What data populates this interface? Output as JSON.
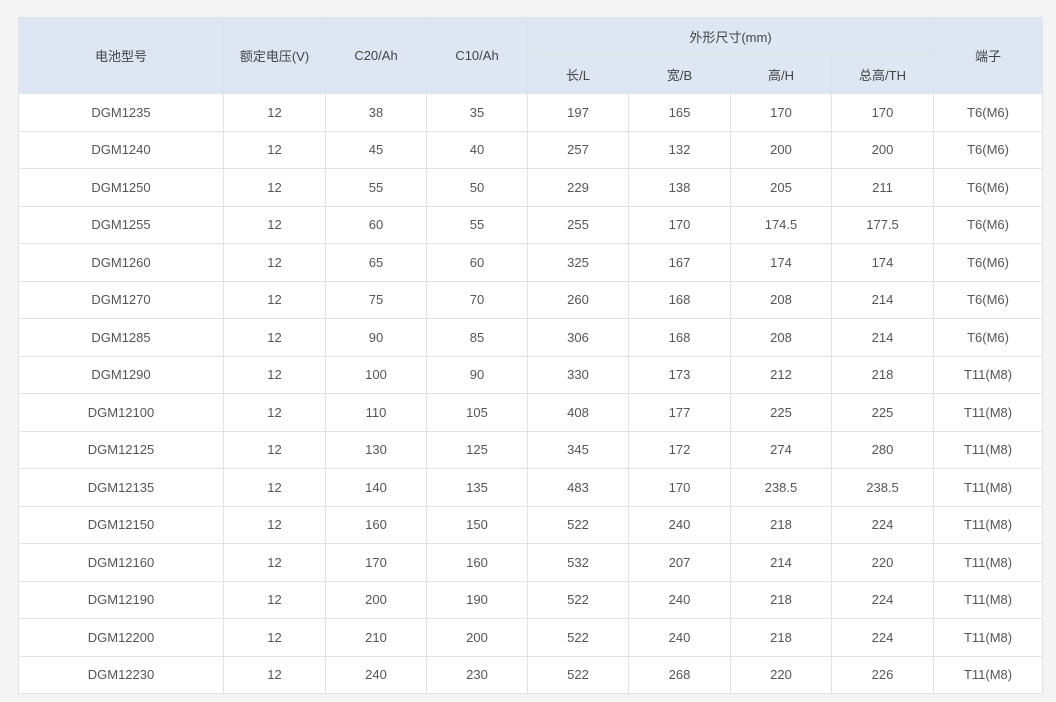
{
  "table": {
    "headers": {
      "model": "电池型号",
      "voltage": "额定电压(V)",
      "c20": "C20/Ah",
      "c10": "C10/Ah",
      "dimensions": "外形尺寸(mm)",
      "length": "长/L",
      "width": "宽/B",
      "height": "高/H",
      "total_height": "总高/TH",
      "terminal": "端子"
    },
    "rows": [
      [
        "DGM1235",
        "12",
        "38",
        "35",
        "197",
        "165",
        "170",
        "170",
        "T6(M6)"
      ],
      [
        "DGM1240",
        "12",
        "45",
        "40",
        "257",
        "132",
        "200",
        "200",
        "T6(M6)"
      ],
      [
        "DGM1250",
        "12",
        "55",
        "50",
        "229",
        "138",
        "205",
        "211",
        "T6(M6)"
      ],
      [
        "DGM1255",
        "12",
        "60",
        "55",
        "255",
        "170",
        "174.5",
        "177.5",
        "T6(M6)"
      ],
      [
        "DGM1260",
        "12",
        "65",
        "60",
        "325",
        "167",
        "174",
        "174",
        "T6(M6)"
      ],
      [
        "DGM1270",
        "12",
        "75",
        "70",
        "260",
        "168",
        "208",
        "214",
        "T6(M6)"
      ],
      [
        "DGM1285",
        "12",
        "90",
        "85",
        "306",
        "168",
        "208",
        "214",
        "T6(M6)"
      ],
      [
        "DGM1290",
        "12",
        "100",
        "90",
        "330",
        "173",
        "212",
        "218",
        "T11(M8)"
      ],
      [
        "DGM12100",
        "12",
        "110",
        "105",
        "408",
        "177",
        "225",
        "225",
        "T11(M8)"
      ],
      [
        "DGM12125",
        "12",
        "130",
        "125",
        "345",
        "172",
        "274",
        "280",
        "T11(M8)"
      ],
      [
        "DGM12135",
        "12",
        "140",
        "135",
        "483",
        "170",
        "238.5",
        "238.5",
        "T11(M8)"
      ],
      [
        "DGM12150",
        "12",
        "160",
        "150",
        "522",
        "240",
        "218",
        "224",
        "T11(M8)"
      ],
      [
        "DGM12160",
        "12",
        "170",
        "160",
        "532",
        "207",
        "214",
        "220",
        "T11(M8)"
      ],
      [
        "DGM12190",
        "12",
        "200",
        "190",
        "522",
        "240",
        "218",
        "224",
        "T11(M8)"
      ],
      [
        "DGM12200",
        "12",
        "210",
        "200",
        "522",
        "240",
        "218",
        "224",
        "T11(M8)"
      ],
      [
        "DGM12230",
        "12",
        "240",
        "230",
        "522",
        "268",
        "220",
        "226",
        "T11(M8)"
      ]
    ]
  }
}
